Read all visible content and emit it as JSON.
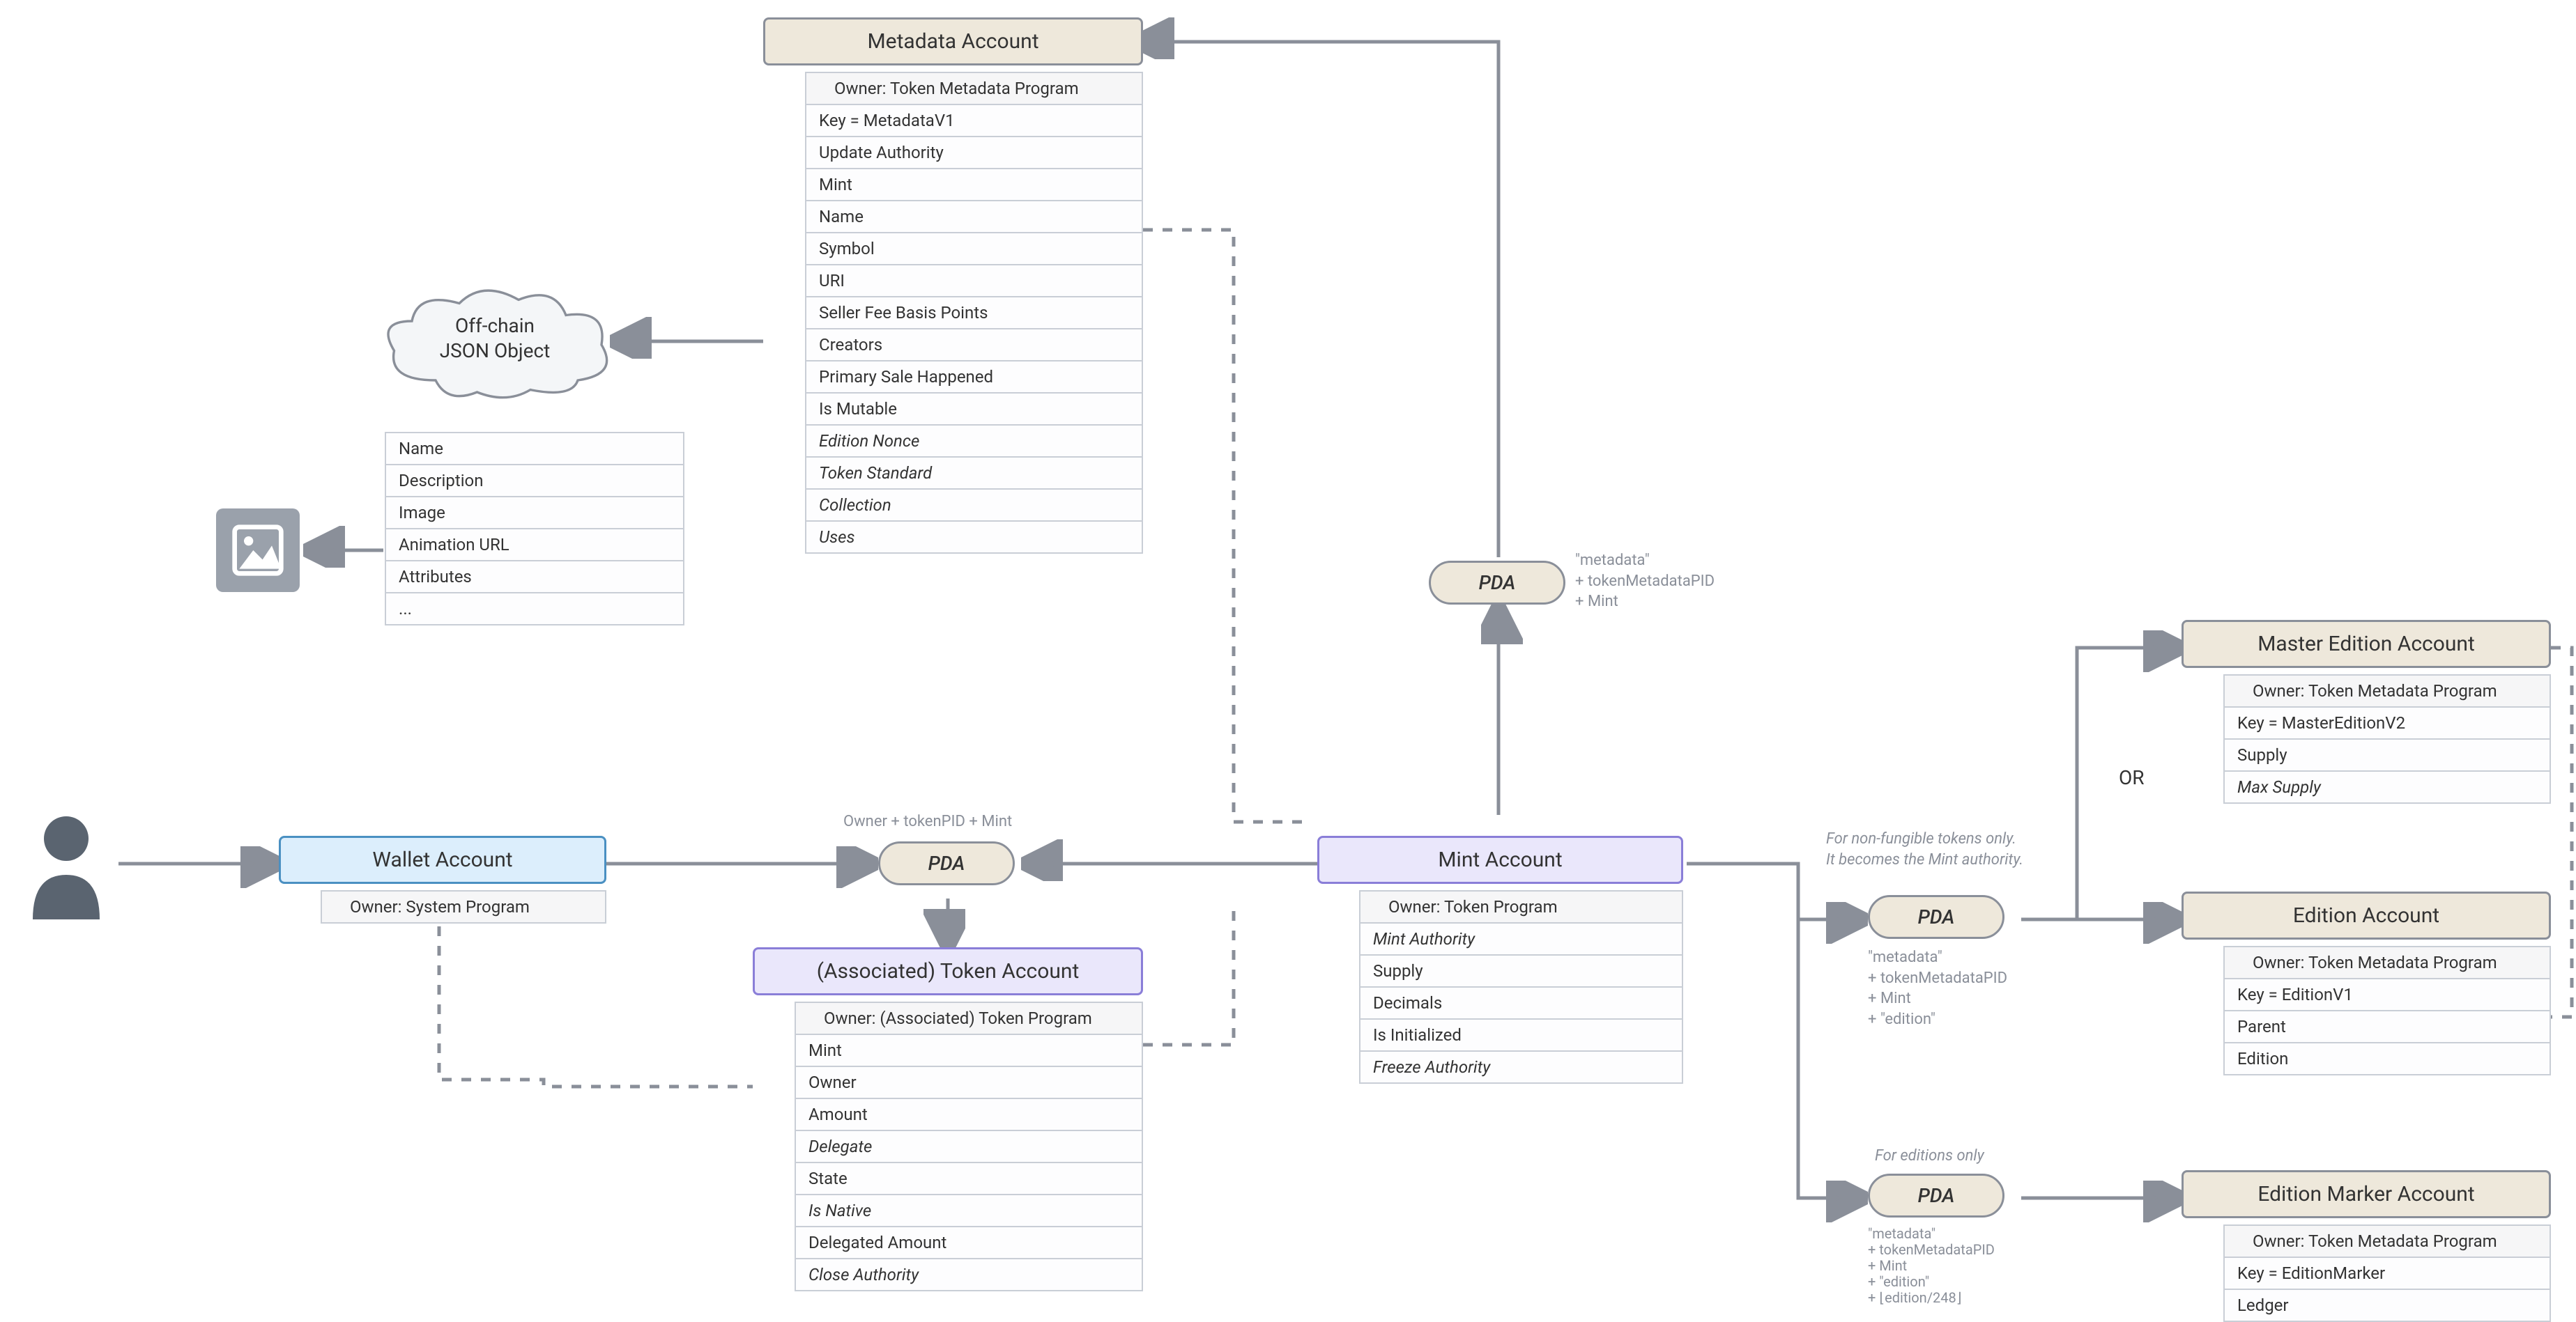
{
  "orLabel": "OR",
  "pda": {
    "label": "PDA",
    "tokenSeeds": "Owner + tokenPID + Mint",
    "metadataSeeds": [
      "\"metadata\"",
      "+ tokenMetadataPID",
      "+ Mint"
    ]
  },
  "wallet": {
    "title": "Wallet Account",
    "owner": "Owner: System Program"
  },
  "token": {
    "title": "(Associated) Token Account",
    "rows": [
      {
        "t": "Owner: (Associated) Token Program",
        "indent": true
      },
      {
        "t": "Mint"
      },
      {
        "t": "Owner"
      },
      {
        "t": "Amount"
      },
      {
        "t": "Delegate",
        "italic": true
      },
      {
        "t": "State"
      },
      {
        "t": "Is Native",
        "italic": true
      },
      {
        "t": "Delegated Amount"
      },
      {
        "t": "Close Authority",
        "italic": true
      }
    ]
  },
  "mint": {
    "title": "Mint Account",
    "rows": [
      {
        "t": "Owner: Token Program",
        "indent": true
      },
      {
        "t": "Mint Authority",
        "italic": true
      },
      {
        "t": "Supply"
      },
      {
        "t": "Decimals"
      },
      {
        "t": "Is Initialized"
      },
      {
        "t": "Freeze Authority",
        "italic": true
      }
    ]
  },
  "metadata": {
    "title": "Metadata Account",
    "rows": [
      {
        "t": "Owner: Token Metadata Program",
        "indent": true
      },
      {
        "t": "Key = MetadataV1"
      },
      {
        "t": "Update Authority"
      },
      {
        "t": "Mint"
      },
      {
        "t": "Name"
      },
      {
        "t": "Symbol"
      },
      {
        "t": "URI"
      },
      {
        "t": "Seller Fee Basis Points"
      },
      {
        "t": "Creators"
      },
      {
        "t": "Primary Sale Happened"
      },
      {
        "t": "Is Mutable"
      },
      {
        "t": "Edition Nonce",
        "italic": true
      },
      {
        "t": "Token Standard",
        "italic": true
      },
      {
        "t": "Collection",
        "italic": true
      },
      {
        "t": "Uses",
        "italic": true
      }
    ]
  },
  "json": {
    "cloud": [
      "Off-chain",
      "JSON Object"
    ],
    "rows": [
      {
        "t": "Name"
      },
      {
        "t": "Description"
      },
      {
        "t": "Image"
      },
      {
        "t": "Animation URL"
      },
      {
        "t": "Attributes"
      },
      {
        "t": "..."
      }
    ]
  },
  "rightPda1": {
    "note": [
      "For non-fungible tokens only.",
      "It becomes the Mint authority."
    ],
    "seeds": [
      "\"metadata\"",
      "+ tokenMetadataPID",
      "+ Mint",
      "+ \"edition\""
    ]
  },
  "rightPda2": {
    "note": "For editions only",
    "seeds": [
      "\"metadata\"",
      "+ tokenMetadataPID",
      "+ Mint",
      "+ \"edition\"",
      "+ ⌊edition/248⌋"
    ]
  },
  "masterEdition": {
    "title": "Master Edition Account",
    "rows": [
      {
        "t": "Owner: Token Metadata Program",
        "indent": true
      },
      {
        "t": "Key = MasterEditionV2"
      },
      {
        "t": "Supply"
      },
      {
        "t": "Max Supply",
        "italic": true
      }
    ]
  },
  "edition": {
    "title": "Edition Account",
    "rows": [
      {
        "t": "Owner: Token Metadata Program",
        "indent": true
      },
      {
        "t": "Key = EditionV1"
      },
      {
        "t": "Parent"
      },
      {
        "t": "Edition"
      }
    ]
  },
  "editionMarker": {
    "title": "Edition Marker Account",
    "rows": [
      {
        "t": "Owner: Token Metadata Program",
        "indent": true
      },
      {
        "t": "Key = EditionMarker"
      },
      {
        "t": "Ledger"
      }
    ]
  }
}
